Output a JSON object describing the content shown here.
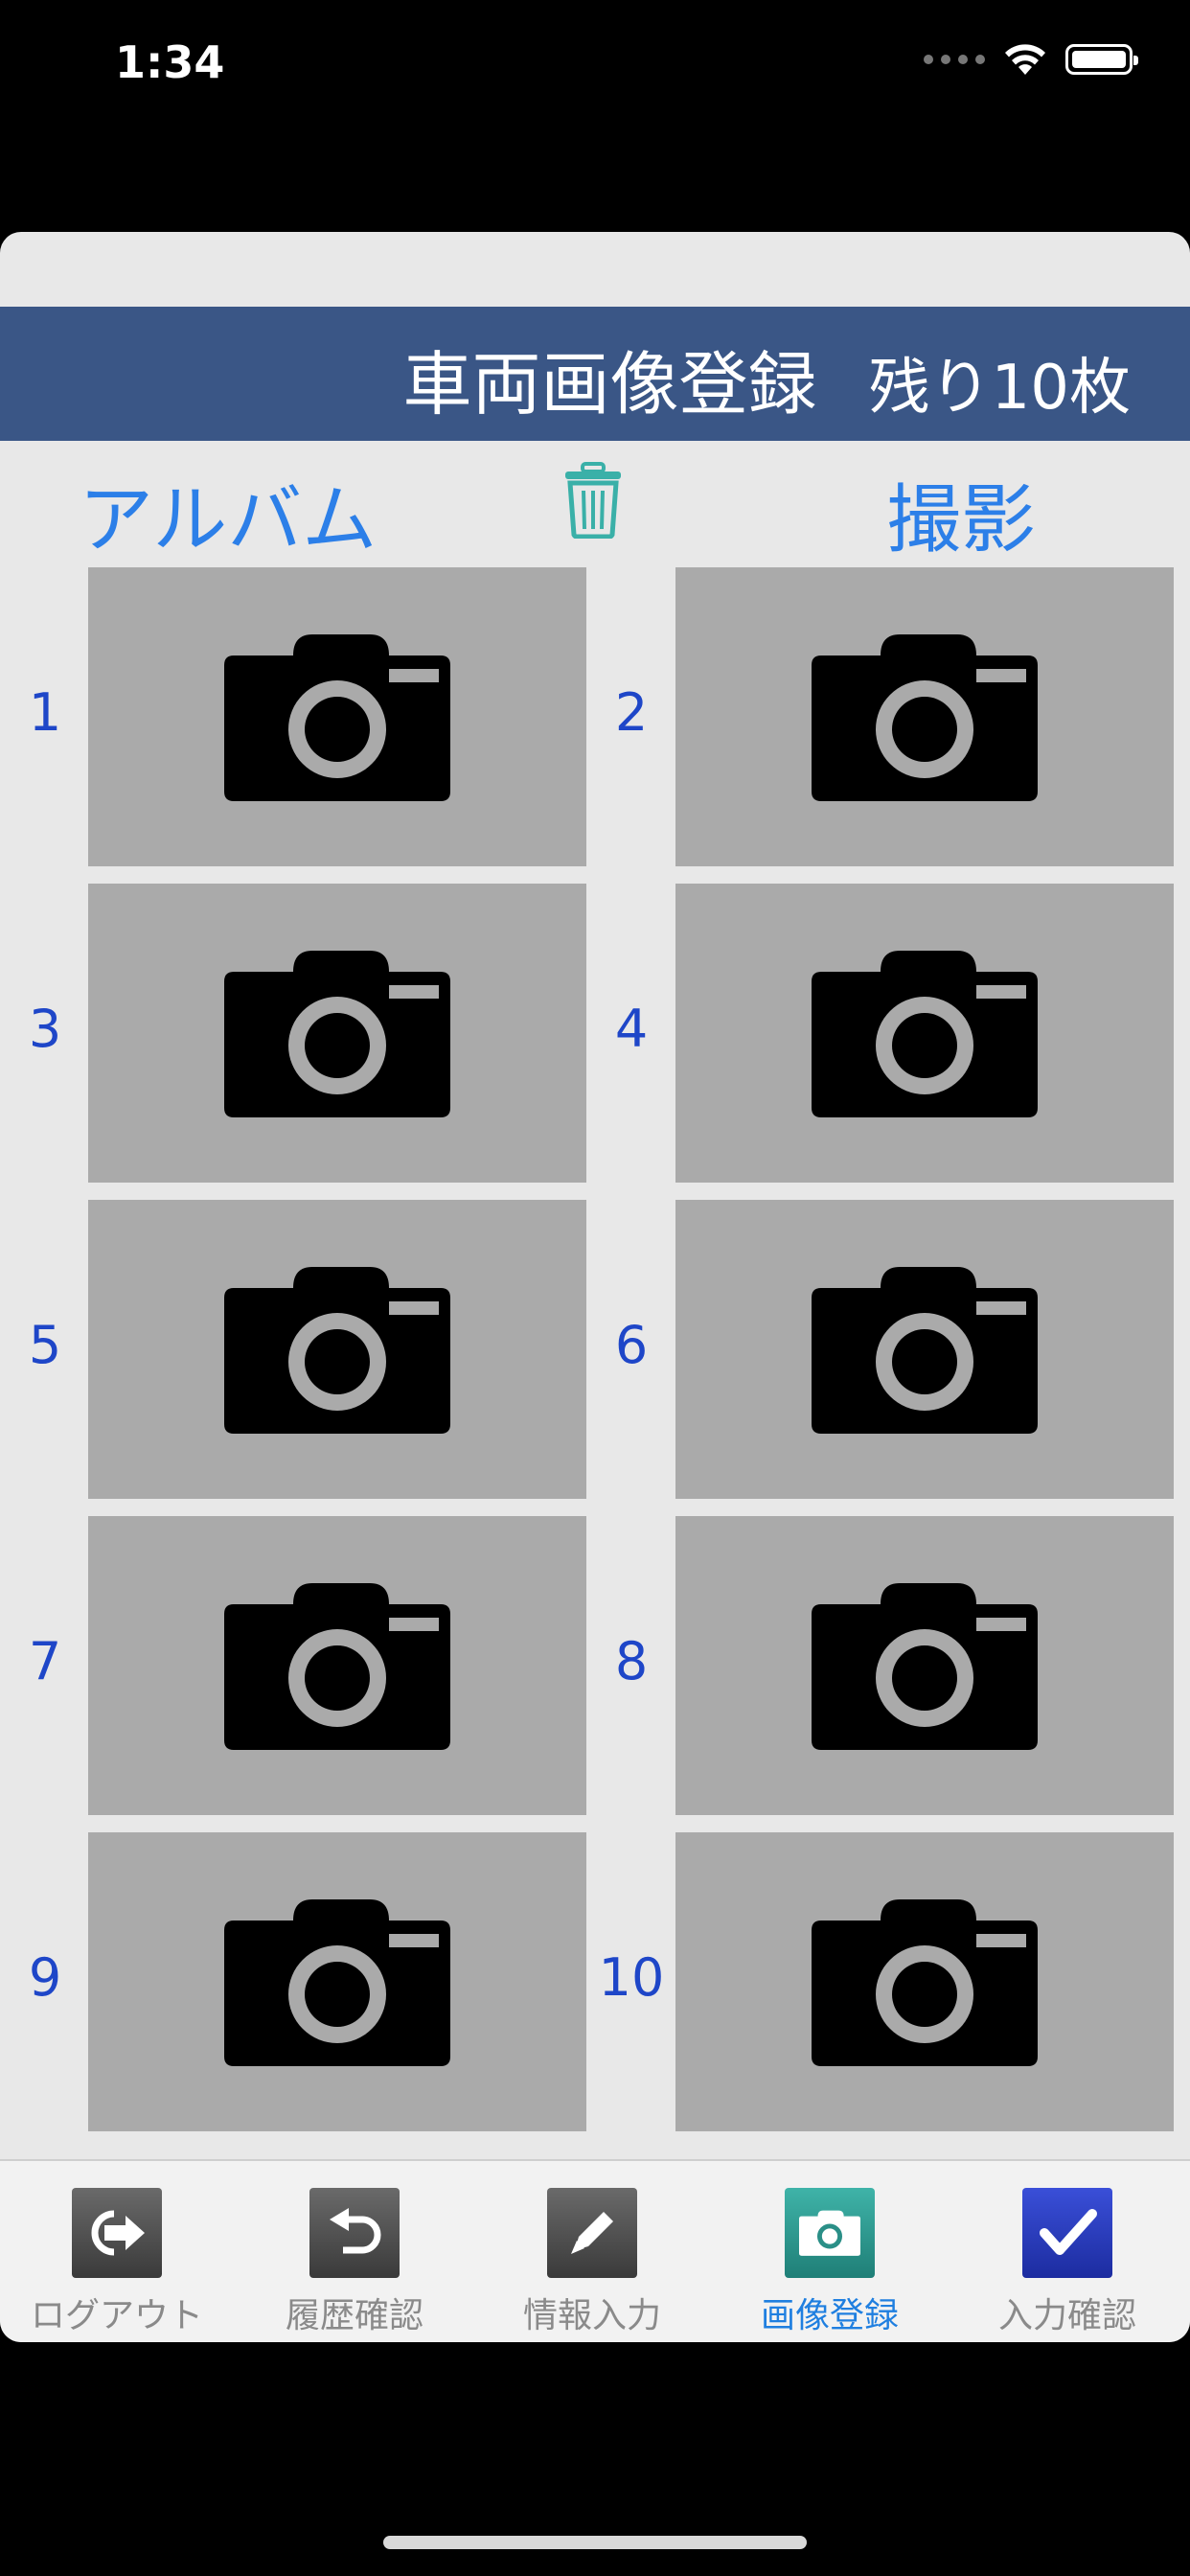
{
  "status_bar": {
    "time": "1:34"
  },
  "header": {
    "title": "車両画像登録",
    "remaining": "残り10枚",
    "color": "#3a5686"
  },
  "actions": {
    "album": "アルバム",
    "delete_icon": "trash-icon",
    "shoot": "撮影",
    "accent": "#2c7fe8"
  },
  "slots": [
    {
      "number": "1",
      "icon": "camera-icon"
    },
    {
      "number": "2",
      "icon": "camera-icon"
    },
    {
      "number": "3",
      "icon": "camera-icon"
    },
    {
      "number": "4",
      "icon": "camera-icon"
    },
    {
      "number": "5",
      "icon": "camera-icon"
    },
    {
      "number": "6",
      "icon": "camera-icon"
    },
    {
      "number": "7",
      "icon": "camera-icon"
    },
    {
      "number": "8",
      "icon": "camera-icon"
    },
    {
      "number": "9",
      "icon": "camera-icon"
    },
    {
      "number": "10",
      "icon": "camera-icon"
    }
  ],
  "tabs": [
    {
      "label": "ログアウト",
      "icon": "logout-icon",
      "active": false
    },
    {
      "label": "履歴確認",
      "icon": "undo-icon",
      "active": false
    },
    {
      "label": "情報入力",
      "icon": "pencil-icon",
      "active": false
    },
    {
      "label": "画像登録",
      "icon": "camera-icon",
      "active": true
    },
    {
      "label": "入力確認",
      "icon": "checkmark-icon",
      "active": false
    }
  ]
}
